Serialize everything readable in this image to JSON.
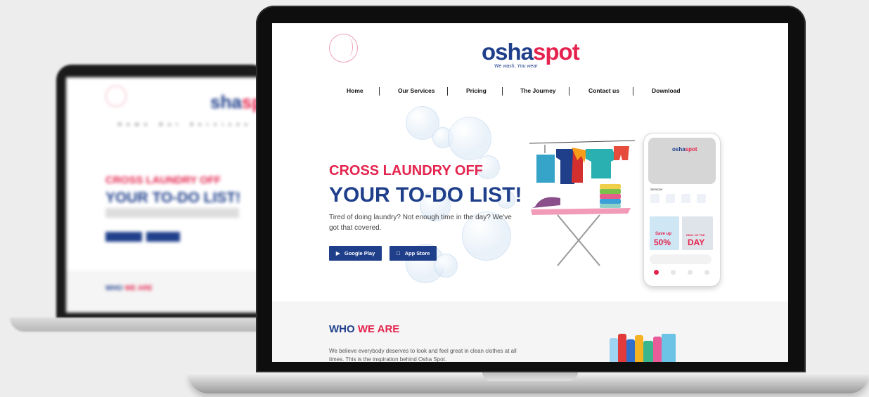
{
  "site": {
    "logo": {
      "o": "o",
      "sha": "sha",
      "spot": "spot",
      "tagline": "We wash, You wear"
    },
    "nav": [
      "Home",
      "Our Services",
      "Pricing",
      "The Journey",
      "Contact us",
      "Download"
    ],
    "hero": {
      "eyebrow": "CROSS LAUNDRY OFF",
      "title": "YOUR TO-DO LIST!",
      "description": "Tired of doing laundry? Not enough time in the day? We've got that covered.",
      "google_play": "Google Play",
      "app_store": "App Store"
    },
    "phone": {
      "logo_a": "osha",
      "logo_b": "spot",
      "services_label": "Services",
      "promo1_big": "50%",
      "promo1_small": "Save up",
      "promo2_small": "DEAL OF THE",
      "promo2_big": "DAY"
    },
    "about": {
      "title_part1": "WHO",
      "title_part2": "WE ARE",
      "description": "We believe everybody deserves to look and feel great in clean clothes at all times. This is the inspiration behind Osha Spot."
    }
  },
  "colors": {
    "brand_blue": "#1f3f8b",
    "brand_red": "#e4244e",
    "icons": [
      "laptop-mockup",
      "play-icon",
      "apple-icon",
      "bubble-decoration"
    ]
  }
}
